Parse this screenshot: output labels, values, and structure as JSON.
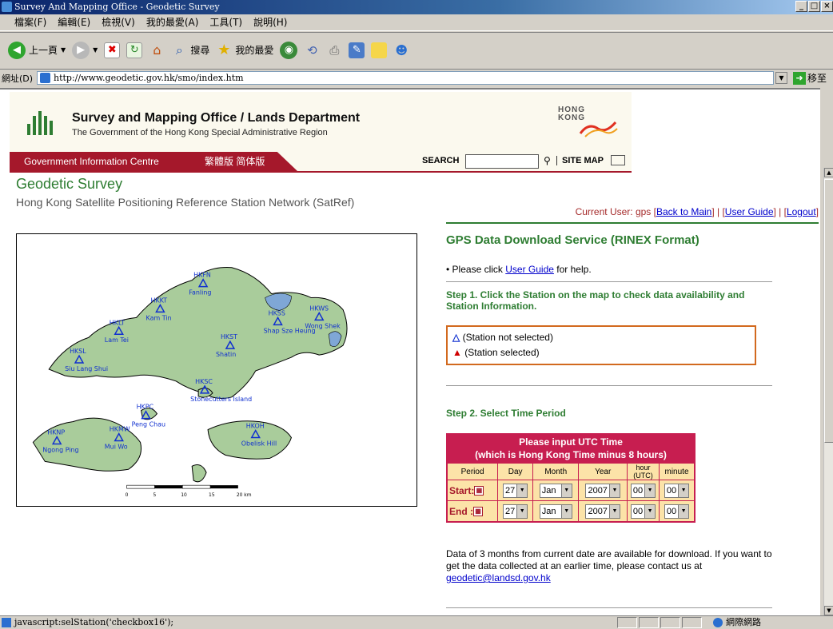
{
  "window": {
    "title": "Survey And Mapping Office - Geodetic Survey"
  },
  "menu": [
    "檔案(F)",
    "編輯(E)",
    "檢視(V)",
    "我的最愛(A)",
    "工具(T)",
    "說明(H)"
  ],
  "toolbar": {
    "back": "上一頁",
    "search": "搜尋",
    "favorites": "我的最愛"
  },
  "address": {
    "label": "網址(D)",
    "url": "http://www.geodetic.gov.hk/smo/index.htm",
    "go": "移至"
  },
  "header": {
    "title": "Survey and Mapping Office / Lands Department",
    "subtitle": "The Government of the Hong Kong Special Administrative Region",
    "hk_logo_line1": "HONG",
    "hk_logo_line2": "KONG",
    "gic": "Government Information Centre",
    "lang": "繁體版  简体版",
    "search_label": "SEARCH",
    "sitemap": "SITE MAP"
  },
  "page": {
    "title": "Geodetic Survey",
    "subtitle": "Hong Kong Satellite Positioning Reference Station Network (SatRef)"
  },
  "map": {
    "stations": [
      {
        "code": "HKFN",
        "name": "Fanling"
      },
      {
        "code": "HKKT",
        "name": "Kam Tin"
      },
      {
        "code": "HKLT",
        "name": "Lam Tei"
      },
      {
        "code": "HKSL",
        "name": "Siu Lang Shui"
      },
      {
        "code": "HKSS",
        "name": "Shap Sze Heung"
      },
      {
        "code": "HKWS",
        "name": "Wong Shek"
      },
      {
        "code": "HKST",
        "name": "Shatin"
      },
      {
        "code": "HKSC",
        "name": "Stonecutters Island"
      },
      {
        "code": "HKPC",
        "name": "Peng Chau"
      },
      {
        "code": "HKNP",
        "name": "Ngong Ping"
      },
      {
        "code": "HKMW",
        "name": "Mui Wo"
      },
      {
        "code": "HKOH",
        "name": "Obelisk Hill"
      }
    ],
    "scale_labels": [
      "0",
      "5",
      "10",
      "15",
      "20 km"
    ]
  },
  "user": {
    "text": "Current User: gps",
    "back_to_main": "Back to Main",
    "user_guide": "User Guide",
    "logout": "Logout"
  },
  "service": {
    "title": "GPS Data Download Service (RINEX Format)",
    "help_prefix": "Please click",
    "help_link": "User Guide",
    "help_suffix": "for help.",
    "step1": "Step 1. Click the Station on the map to check data availability and Station Information.",
    "legend_not_selected": "(Station not selected)",
    "legend_selected": "(Station selected)",
    "step2": "Step 2. Select Time Period",
    "utc_line1": "Please input UTC Time",
    "utc_line2": "(which is Hong Kong Time minus 8 hours)",
    "columns": [
      "Period",
      "Day",
      "Month",
      "Year",
      "hour (UTC)",
      "minute"
    ],
    "start_label": "Start:",
    "end_label": "End :",
    "start": {
      "day": "27",
      "month": "Jan",
      "year": "2007",
      "hour": "00",
      "minute": "00"
    },
    "end": {
      "day": "27",
      "month": "Jan",
      "year": "2007",
      "hour": "00",
      "minute": "00"
    },
    "note": "Data of 3 months from current date are available for download. If you want to get the data collected at an earlier time, please contact us at",
    "email": "geodetic@landsd.gov.hk"
  },
  "status": {
    "text": "javascript:selStation('checkbox16');",
    "zone": "網際網路"
  },
  "colors": {
    "green": "#2e7d32",
    "red": "#a5182b",
    "land": "#a9cc9b",
    "water": "#7fa7d6"
  }
}
